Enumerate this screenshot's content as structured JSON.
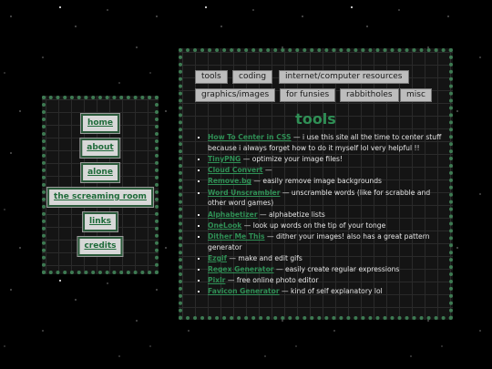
{
  "sidebar": {
    "items": [
      {
        "label": "home"
      },
      {
        "label": "about"
      },
      {
        "label": "alone"
      },
      {
        "label": "the screaming room"
      },
      {
        "label": "links"
      },
      {
        "label": "credits"
      }
    ]
  },
  "tabs": [
    {
      "label": "tools"
    },
    {
      "label": "coding"
    },
    {
      "label": "internet/computer resources"
    },
    {
      "label": "graphics/images"
    },
    {
      "label": "for funsies"
    },
    {
      "label": "rabbitholes"
    },
    {
      "label": "misc"
    }
  ],
  "main": {
    "title": "tools",
    "items": [
      {
        "name": "How To Center in CSS",
        "desc": " — i use this site all the time to center stuff because i always forget how to do it myself lol very helpful !!"
      },
      {
        "name": "TinyPNG",
        "desc": " — optimize your image files!"
      },
      {
        "name": "Cloud Convert",
        "desc": " —"
      },
      {
        "name": "Remove.bg",
        "desc": " — easily remove image backgrounds"
      },
      {
        "name": "Word Unscrambler",
        "desc": " — unscramble words (like for scrabble and other word games)"
      },
      {
        "name": "Alphabetizer",
        "desc": " — alphabetize lists"
      },
      {
        "name": "OneLook",
        "desc": " — look up words on the tip of your tonge"
      },
      {
        "name": "Dither Me This",
        "desc": " — dither your images! also has a great pattern generator"
      },
      {
        "name": "Ezgif",
        "desc": " — make and edit gifs"
      },
      {
        "name": "Regex Generator",
        "desc": " — easily create regular expressions"
      },
      {
        "name": "Pixlr",
        "desc": " — free online photo editor"
      },
      {
        "name": "Favicon Generator",
        "desc": " — kind of self explanatory lol"
      }
    ]
  },
  "colors": {
    "accent": "#2f8f55",
    "border": "#3d7a52",
    "panel": "#141414"
  }
}
